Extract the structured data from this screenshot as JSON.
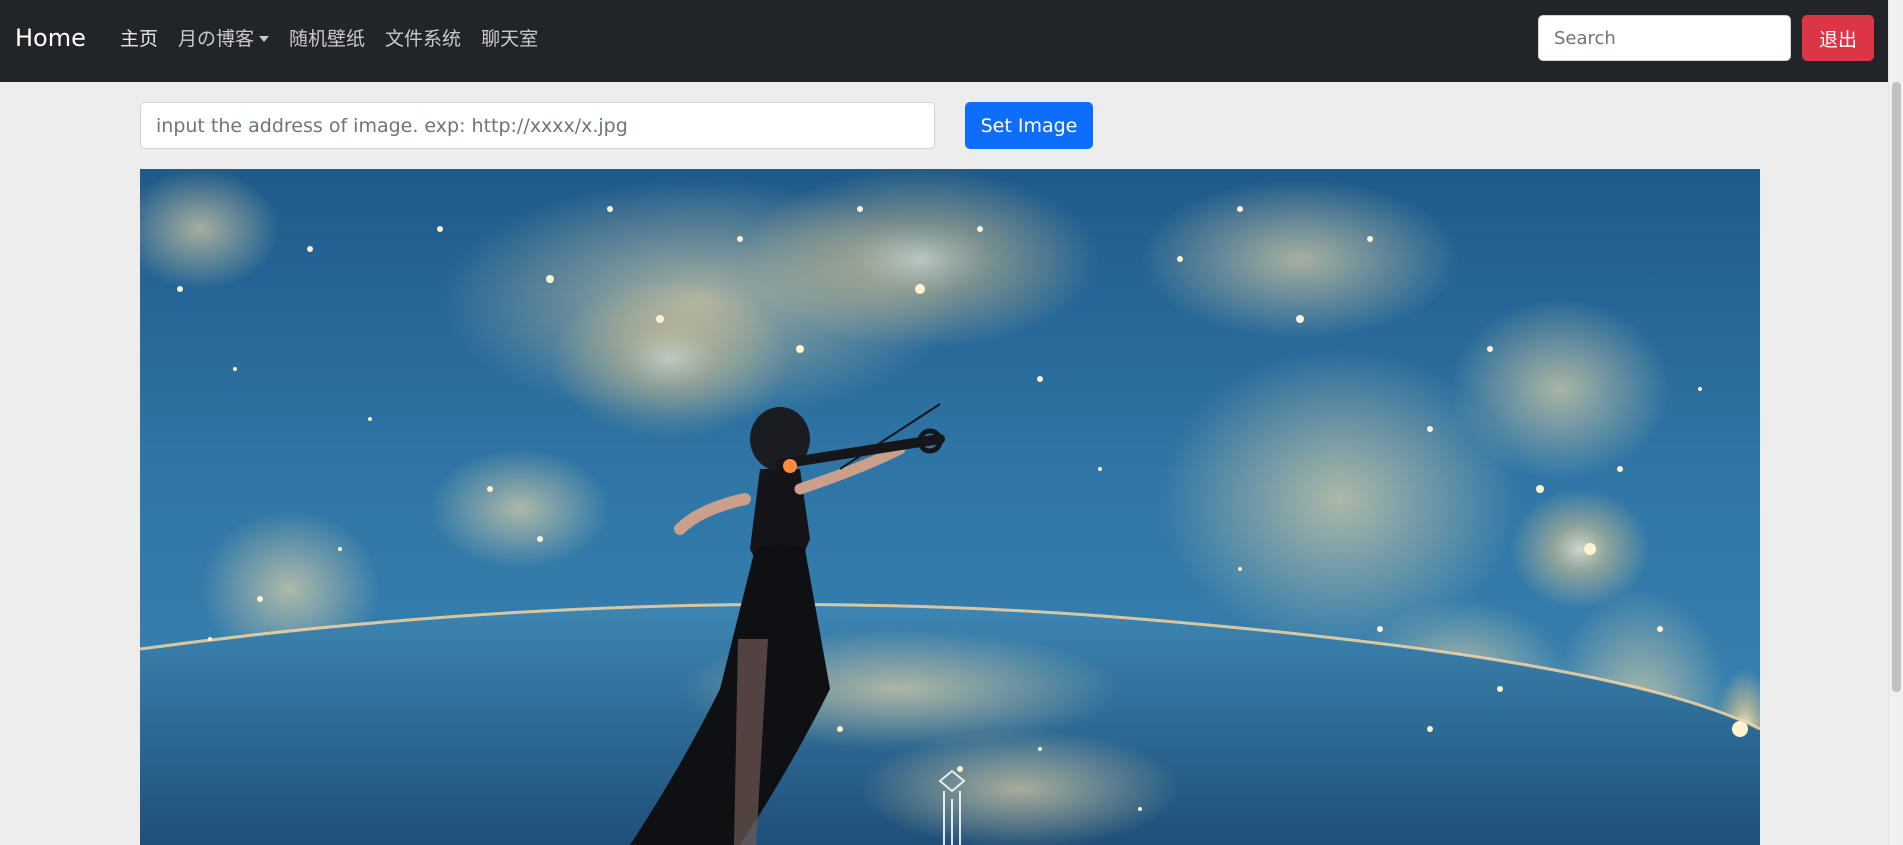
{
  "navbar": {
    "brand": "Home",
    "links": [
      {
        "label": "主页",
        "dropdown": false
      },
      {
        "label": "月の博客",
        "dropdown": true
      },
      {
        "label": "随机壁纸",
        "dropdown": false
      },
      {
        "label": "文件系统",
        "dropdown": false
      },
      {
        "label": "聊天室",
        "dropdown": false
      }
    ],
    "search_placeholder": "Search",
    "logout_label": "退出"
  },
  "image_form": {
    "address_placeholder": "input the address of image. exp: http://xxxx/x.jpg",
    "set_button_label": "Set Image"
  },
  "wallpaper": {
    "description_icon": "wallpaper-image",
    "colors": {
      "sky_top": "#1f5a8a",
      "sky_mid": "#2f76a6",
      "city_lights": "#ffe9b8",
      "earth": "#2c6a95"
    }
  },
  "colors": {
    "navbar_bg": "#212529",
    "page_bg": "#ededed",
    "primary": "#0d6efd",
    "danger": "#dc3545"
  }
}
